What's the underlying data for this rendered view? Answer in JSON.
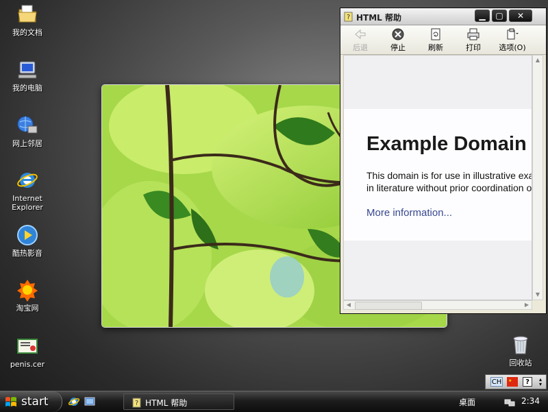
{
  "desktop": {
    "icons": [
      {
        "label": "我的文档",
        "icon": "folder-icon"
      },
      {
        "label": "我的电脑",
        "icon": "computer-icon"
      },
      {
        "label": "网上邻居",
        "icon": "network-icon"
      },
      {
        "label": "Internet Explorer",
        "icon": "ie-icon"
      },
      {
        "label": "酷热影音",
        "icon": "media-player-icon"
      },
      {
        "label": "淘宝网",
        "icon": "taobao-icon"
      },
      {
        "label": "penis.cer",
        "icon": "certificate-icon"
      },
      {
        "label": "回收站",
        "icon": "recycle-bin-icon"
      }
    ]
  },
  "window": {
    "title": "HTML 帮助",
    "controls": {
      "minimize": "▁",
      "maximize": "▢",
      "close": "✕"
    },
    "toolbar": {
      "back": "后退",
      "stop": "停止",
      "refresh": "刷新",
      "print": "打印",
      "options": "选项(O)"
    },
    "page": {
      "heading": "Example Domain",
      "para_line1": "This domain is for use in illustrative examples in documents. You may use this",
      "para_line2": "in literature without prior coordination or asking for permission.",
      "link": "More information..."
    }
  },
  "language_bar": {
    "lang": "CH",
    "help": "?"
  },
  "taskbar": {
    "start": "start",
    "task_title": "HTML 帮助",
    "desktop_label": "桌面",
    "clock": "2:34"
  },
  "colors": {
    "link": "#38488f",
    "taskbar": "#1d1d1d",
    "window_frame": "#ece9d8"
  }
}
